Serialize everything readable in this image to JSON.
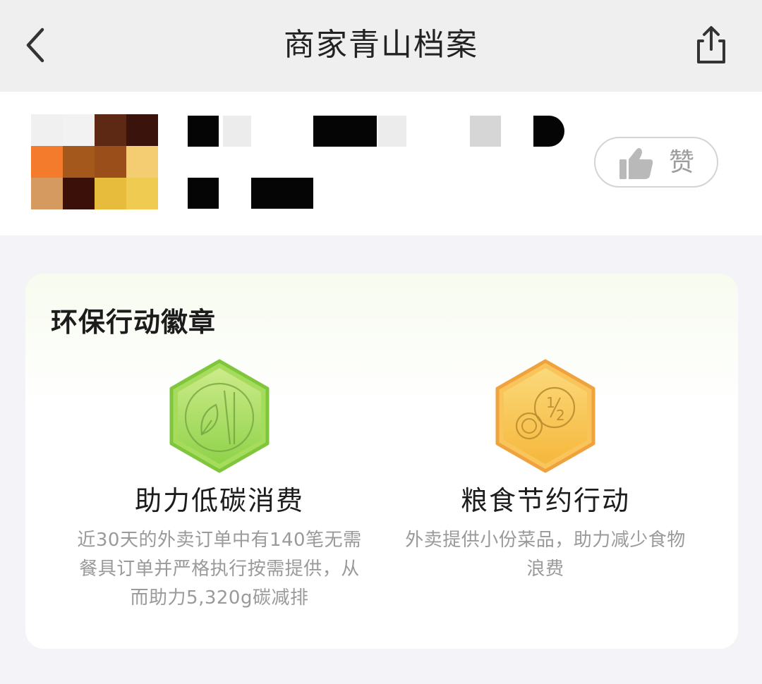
{
  "nav": {
    "title": "商家青山档案",
    "back_icon": "chevron-left-icon",
    "share_icon": "share-icon"
  },
  "merchant": {
    "name_redacted": true,
    "like_label": "赞",
    "like_icon": "thumbs-up-icon"
  },
  "eco_section": {
    "title": "环保行动徽章",
    "badges": [
      {
        "name": "助力低碳消费",
        "description": "近30天的外卖订单中有140笔无需餐具订单并严格执行按需提供，从而助力5,320g碳减排",
        "icon": "leaf-chopsticks-icon",
        "color": "#8fd24a"
      },
      {
        "name": "粮食节约行动",
        "description": "外卖提供小份菜品，助力减少食物浪费",
        "icon": "half-portion-icon",
        "color": "#f6b73c"
      }
    ]
  }
}
